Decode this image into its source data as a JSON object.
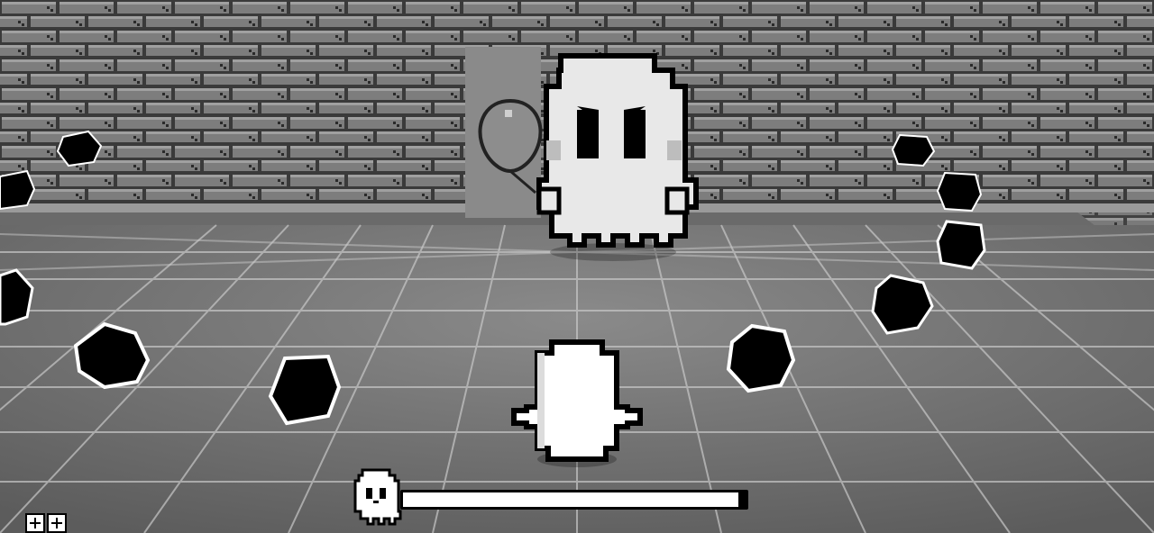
{
  "game": {
    "boss": {
      "name": "ghost-boss",
      "health_fraction": 0.98
    },
    "player": {
      "lives": 2
    },
    "colors": {
      "wall": "#5e5e5e",
      "floor": "#7a7a7a",
      "black": "#000000",
      "white": "#ffffff"
    },
    "icons": {
      "life": "plus-icon",
      "boss": "ghost-icon",
      "balloon": "balloon-icon"
    }
  }
}
